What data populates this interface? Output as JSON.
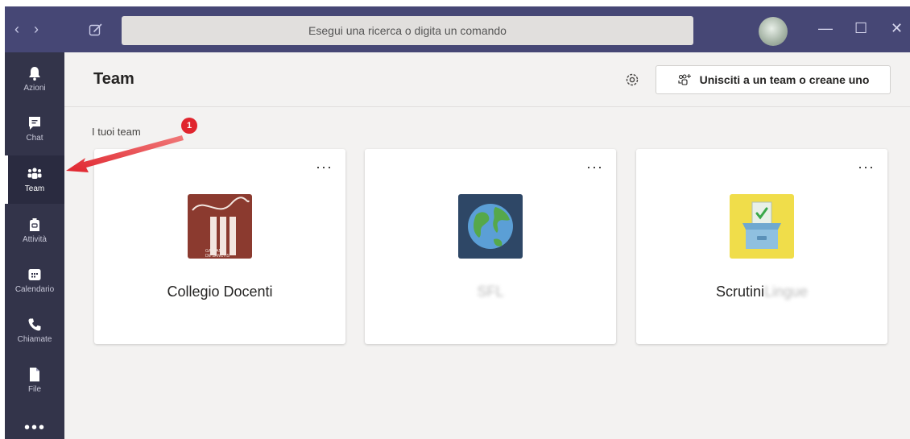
{
  "titlebar": {
    "back_icon": "chevron-left-icon",
    "forward_icon": "chevron-right-icon",
    "search_placeholder": "Esegui una ricerca o digita un comando",
    "minimize": "—",
    "maximize": "☐",
    "close": "✕"
  },
  "rail": {
    "items": [
      {
        "label": "Azioni",
        "icon": "bell-icon"
      },
      {
        "label": "Chat",
        "icon": "chat-icon"
      },
      {
        "label": "Team",
        "icon": "teams-icon",
        "active": true
      },
      {
        "label": "Attività",
        "icon": "backpack-icon"
      },
      {
        "label": "Calendario",
        "icon": "calendar-icon"
      },
      {
        "label": "Chiamate",
        "icon": "phone-icon"
      },
      {
        "label": "File",
        "icon": "file-icon"
      }
    ],
    "more": "•••"
  },
  "header": {
    "title": "Team",
    "join_button": "Unisciti a un team o creane uno"
  },
  "section_label": "I tuoi team",
  "teams": [
    {
      "name": "Collegio Docenti",
      "name_hidden": "",
      "logo": "school-logo",
      "logo_text_1": "GAETANO",
      "logo_text_2": "DE SANCTIS"
    },
    {
      "name": "",
      "name_hidden": "SFL",
      "logo": "globe-icon"
    },
    {
      "name": "Scrutini",
      "name_hidden": "Lingue",
      "logo": "ballot-box-icon"
    }
  ],
  "card_more": "···",
  "annotation": {
    "badge": "1"
  },
  "colors": {
    "titlebar": "#464775",
    "rail": "#33344a",
    "background": "#f3f2f1",
    "annotation": "#e0252e"
  }
}
